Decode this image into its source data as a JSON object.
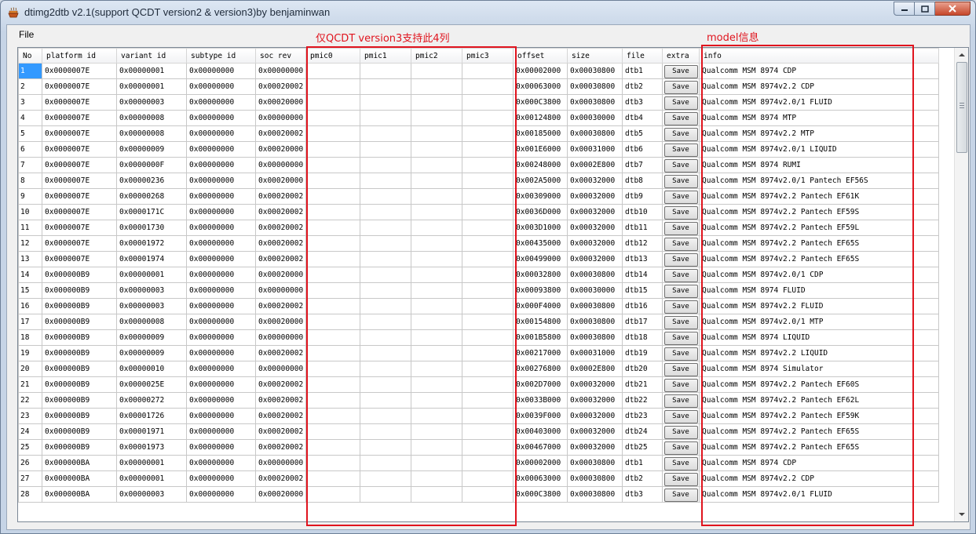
{
  "window": {
    "title": "dtimg2dtb v2.1(support QCDT version2 & version3)by benjaminwan"
  },
  "menu": {
    "file": "File"
  },
  "annotations": {
    "pmic_note": "仅QCDT version3支持此4列",
    "model_note": "model信息"
  },
  "table": {
    "columns": [
      "No",
      "platform id",
      "variant id",
      "subtype id",
      "soc rev",
      "pmic0",
      "pmic1",
      "pmic2",
      "pmic3",
      "offset",
      "size",
      "file",
      "extra",
      "info"
    ],
    "save_label": "Save",
    "selected_row": 1,
    "rows": [
      {
        "no": "1",
        "platform": "0x0000007E",
        "variant": "0x00000001",
        "subtype": "0x00000000",
        "socrev": "0x00000000",
        "offset": "0x00002000",
        "size": "0x00030800",
        "file": "dtb1",
        "info": "Qualcomm MSM 8974 CDP"
      },
      {
        "no": "2",
        "platform": "0x0000007E",
        "variant": "0x00000001",
        "subtype": "0x00000000",
        "socrev": "0x00020002",
        "offset": "0x00063000",
        "size": "0x00030800",
        "file": "dtb2",
        "info": "Qualcomm MSM 8974v2.2 CDP"
      },
      {
        "no": "3",
        "platform": "0x0000007E",
        "variant": "0x00000003",
        "subtype": "0x00000000",
        "socrev": "0x00020000",
        "offset": "0x000C3800",
        "size": "0x00030800",
        "file": "dtb3",
        "info": "Qualcomm MSM 8974v2.0/1 FLUID"
      },
      {
        "no": "4",
        "platform": "0x0000007E",
        "variant": "0x00000008",
        "subtype": "0x00000000",
        "socrev": "0x00000000",
        "offset": "0x00124800",
        "size": "0x00030000",
        "file": "dtb4",
        "info": "Qualcomm MSM 8974 MTP"
      },
      {
        "no": "5",
        "platform": "0x0000007E",
        "variant": "0x00000008",
        "subtype": "0x00000000",
        "socrev": "0x00020002",
        "offset": "0x00185000",
        "size": "0x00030800",
        "file": "dtb5",
        "info": "Qualcomm MSM 8974v2.2 MTP"
      },
      {
        "no": "6",
        "platform": "0x0000007E",
        "variant": "0x00000009",
        "subtype": "0x00000000",
        "socrev": "0x00020000",
        "offset": "0x001E6000",
        "size": "0x00031000",
        "file": "dtb6",
        "info": "Qualcomm MSM 8974v2.0/1 LIQUID"
      },
      {
        "no": "7",
        "platform": "0x0000007E",
        "variant": "0x0000000F",
        "subtype": "0x00000000",
        "socrev": "0x00000000",
        "offset": "0x00248000",
        "size": "0x0002E800",
        "file": "dtb7",
        "info": "Qualcomm MSM 8974 RUMI"
      },
      {
        "no": "8",
        "platform": "0x0000007E",
        "variant": "0x00000236",
        "subtype": "0x00000000",
        "socrev": "0x00020000",
        "offset": "0x002A5000",
        "size": "0x00032000",
        "file": "dtb8",
        "info": "Qualcomm MSM 8974v2.0/1 Pantech EF56S"
      },
      {
        "no": "9",
        "platform": "0x0000007E",
        "variant": "0x00000268",
        "subtype": "0x00000000",
        "socrev": "0x00020002",
        "offset": "0x00309000",
        "size": "0x00032000",
        "file": "dtb9",
        "info": "Qualcomm MSM 8974v2.2 Pantech EF61K"
      },
      {
        "no": "10",
        "platform": "0x0000007E",
        "variant": "0x0000171C",
        "subtype": "0x00000000",
        "socrev": "0x00020002",
        "offset": "0x0036D000",
        "size": "0x00032000",
        "file": "dtb10",
        "info": "Qualcomm MSM 8974v2.2 Pantech EF59S"
      },
      {
        "no": "11",
        "platform": "0x0000007E",
        "variant": "0x00001730",
        "subtype": "0x00000000",
        "socrev": "0x00020002",
        "offset": "0x003D1000",
        "size": "0x00032000",
        "file": "dtb11",
        "info": "Qualcomm MSM 8974v2.2 Pantech EF59L"
      },
      {
        "no": "12",
        "platform": "0x0000007E",
        "variant": "0x00001972",
        "subtype": "0x00000000",
        "socrev": "0x00020002",
        "offset": "0x00435000",
        "size": "0x00032000",
        "file": "dtb12",
        "info": "Qualcomm MSM 8974v2.2 Pantech EF65S"
      },
      {
        "no": "13",
        "platform": "0x0000007E",
        "variant": "0x00001974",
        "subtype": "0x00000000",
        "socrev": "0x00020002",
        "offset": "0x00499000",
        "size": "0x00032000",
        "file": "dtb13",
        "info": "Qualcomm MSM 8974v2.2 Pantech EF65S"
      },
      {
        "no": "14",
        "platform": "0x000000B9",
        "variant": "0x00000001",
        "subtype": "0x00000000",
        "socrev": "0x00020000",
        "offset": "0x00032800",
        "size": "0x00030800",
        "file": "dtb14",
        "info": "Qualcomm MSM 8974v2.0/1 CDP"
      },
      {
        "no": "15",
        "platform": "0x000000B9",
        "variant": "0x00000003",
        "subtype": "0x00000000",
        "socrev": "0x00000000",
        "offset": "0x00093800",
        "size": "0x00030000",
        "file": "dtb15",
        "info": "Qualcomm MSM 8974 FLUID"
      },
      {
        "no": "16",
        "platform": "0x000000B9",
        "variant": "0x00000003",
        "subtype": "0x00000000",
        "socrev": "0x00020002",
        "offset": "0x000F4000",
        "size": "0x00030800",
        "file": "dtb16",
        "info": "Qualcomm MSM 8974v2.2 FLUID"
      },
      {
        "no": "17",
        "platform": "0x000000B9",
        "variant": "0x00000008",
        "subtype": "0x00000000",
        "socrev": "0x00020000",
        "offset": "0x00154800",
        "size": "0x00030800",
        "file": "dtb17",
        "info": "Qualcomm MSM 8974v2.0/1 MTP"
      },
      {
        "no": "18",
        "platform": "0x000000B9",
        "variant": "0x00000009",
        "subtype": "0x00000000",
        "socrev": "0x00000000",
        "offset": "0x001B5800",
        "size": "0x00030800",
        "file": "dtb18",
        "info": "Qualcomm MSM 8974 LIQUID"
      },
      {
        "no": "19",
        "platform": "0x000000B9",
        "variant": "0x00000009",
        "subtype": "0x00000000",
        "socrev": "0x00020002",
        "offset": "0x00217000",
        "size": "0x00031000",
        "file": "dtb19",
        "info": "Qualcomm MSM 8974v2.2 LIQUID"
      },
      {
        "no": "20",
        "platform": "0x000000B9",
        "variant": "0x00000010",
        "subtype": "0x00000000",
        "socrev": "0x00000000",
        "offset": "0x00276800",
        "size": "0x0002E800",
        "file": "dtb20",
        "info": "Qualcomm MSM 8974 Simulator"
      },
      {
        "no": "21",
        "platform": "0x000000B9",
        "variant": "0x0000025E",
        "subtype": "0x00000000",
        "socrev": "0x00020002",
        "offset": "0x002D7000",
        "size": "0x00032000",
        "file": "dtb21",
        "info": "Qualcomm MSM 8974v2.2 Pantech EF60S"
      },
      {
        "no": "22",
        "platform": "0x000000B9",
        "variant": "0x00000272",
        "subtype": "0x00000000",
        "socrev": "0x00020002",
        "offset": "0x0033B000",
        "size": "0x00032000",
        "file": "dtb22",
        "info": "Qualcomm MSM 8974v2.2 Pantech EF62L"
      },
      {
        "no": "23",
        "platform": "0x000000B9",
        "variant": "0x00001726",
        "subtype": "0x00000000",
        "socrev": "0x00020002",
        "offset": "0x0039F000",
        "size": "0x00032000",
        "file": "dtb23",
        "info": "Qualcomm MSM 8974v2.2 Pantech EF59K"
      },
      {
        "no": "24",
        "platform": "0x000000B9",
        "variant": "0x00001971",
        "subtype": "0x00000000",
        "socrev": "0x00020002",
        "offset": "0x00403000",
        "size": "0x00032000",
        "file": "dtb24",
        "info": "Qualcomm MSM 8974v2.2 Pantech EF65S"
      },
      {
        "no": "25",
        "platform": "0x000000B9",
        "variant": "0x00001973",
        "subtype": "0x00000000",
        "socrev": "0x00020002",
        "offset": "0x00467000",
        "size": "0x00032000",
        "file": "dtb25",
        "info": "Qualcomm MSM 8974v2.2 Pantech EF65S"
      },
      {
        "no": "26",
        "platform": "0x000000BA",
        "variant": "0x00000001",
        "subtype": "0x00000000",
        "socrev": "0x00000000",
        "offset": "0x00002000",
        "size": "0x00030800",
        "file": "dtb1",
        "info": "Qualcomm MSM 8974 CDP"
      },
      {
        "no": "27",
        "platform": "0x000000BA",
        "variant": "0x00000001",
        "subtype": "0x00000000",
        "socrev": "0x00020002",
        "offset": "0x00063000",
        "size": "0x00030800",
        "file": "dtb2",
        "info": "Qualcomm MSM 8974v2.2 CDP"
      },
      {
        "no": "28",
        "platform": "0x000000BA",
        "variant": "0x00000003",
        "subtype": "0x00000000",
        "socrev": "0x00020000",
        "offset": "0x000C3800",
        "size": "0x00030800",
        "file": "dtb3",
        "info": "Qualcomm MSM 8974v2.0/1 FLUID"
      }
    ]
  },
  "colors": {
    "annotation_red": "#e0141e",
    "selection_blue": "#3399ff",
    "close_button": "#c7472b"
  },
  "icons": [
    "app-icon",
    "minimize-icon",
    "maximize-icon",
    "close-icon",
    "scroll-up-icon",
    "scroll-down-icon"
  ]
}
